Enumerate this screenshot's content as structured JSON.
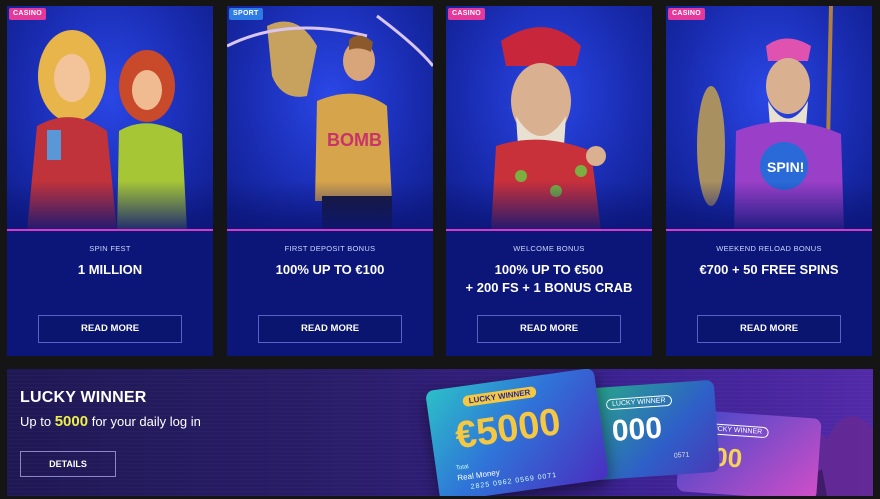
{
  "promos": [
    {
      "badge": "CASINO",
      "subtitle": "SPIN FEST",
      "title_lines": [
        "1 MILLION"
      ],
      "button": "READ MORE"
    },
    {
      "badge": "SPORT",
      "subtitle": "FIRST DEPOSIT BONUS",
      "title_lines": [
        "100% UP TO €100"
      ],
      "button": "READ MORE"
    },
    {
      "badge": "CASINO",
      "subtitle": "WELCOME BONUS",
      "title_lines": [
        "100% UP TO €500",
        "+ 200 FS + 1 BONUS CRAB"
      ],
      "button": "READ MORE"
    },
    {
      "badge": "CASINO",
      "subtitle": "WEEKEND RELOAD BONUS",
      "title_lines": [
        "€700 + 50 FREE SPINS"
      ],
      "button": "READ MORE"
    }
  ],
  "banner": {
    "title": "LUCKY WINNER",
    "desc_prefix": "Up to",
    "amount": "5000",
    "desc_suffix": "for your daily log in",
    "button": "DETAILS",
    "gift_cards": [
      {
        "label": "LUCKY WINNER",
        "value": "€5000",
        "foot_label": "Total",
        "foot_value": "Real Money",
        "number": "2825 0962 0569 0071"
      },
      {
        "label": "LUCKY WINNER",
        "value": "000",
        "number": "0571"
      },
      {
        "label": "LUCKY WINNER",
        "value": "000"
      }
    ]
  },
  "colors": {
    "card_bg": "#0b1678",
    "casino_badge": "#e4399a",
    "sport_badge": "#2e7be6",
    "banner_amount": "#ecef4a"
  }
}
